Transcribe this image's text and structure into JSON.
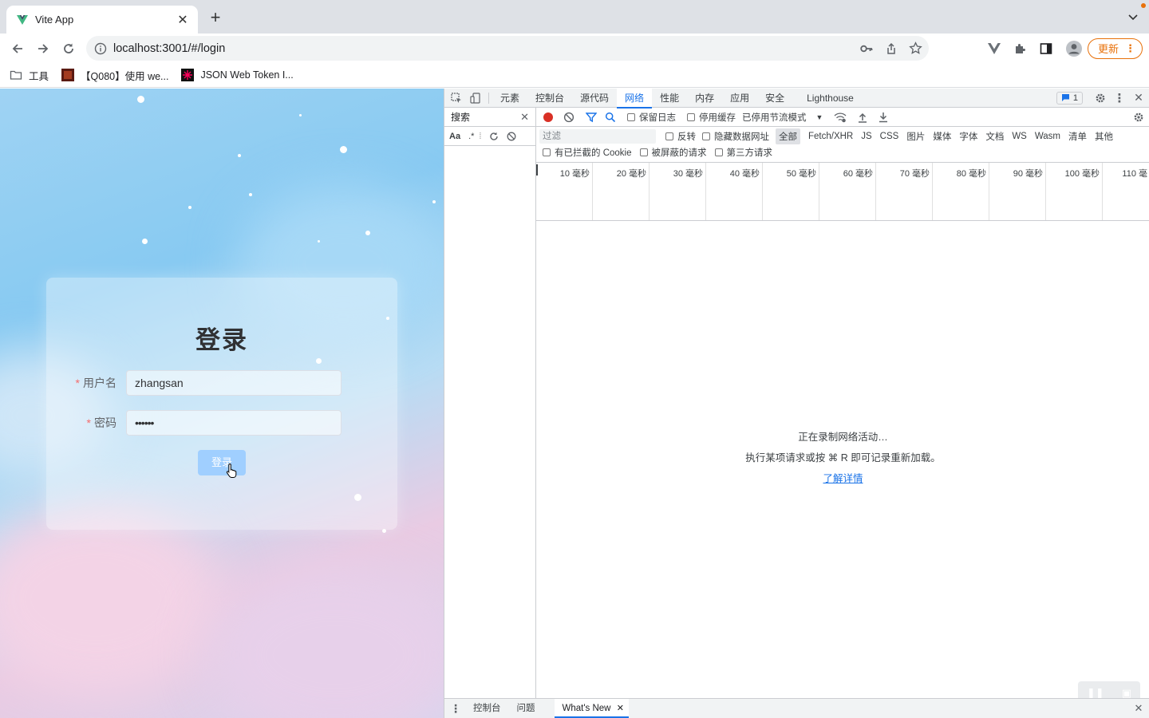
{
  "browser": {
    "tab_title": "Vite App",
    "url": "localhost:3001/#/login",
    "update_label": "更新",
    "bookmarks": [
      "工具",
      "【Q080】使用 we...",
      "JSON Web Token I..."
    ]
  },
  "login": {
    "title": "登录",
    "username_label": "用户名",
    "username_value": "zhangsan",
    "password_label": "密码",
    "password_value": "••••••",
    "required_mark": "*",
    "submit_label": "登录"
  },
  "devtools": {
    "tabs": [
      "元素",
      "控制台",
      "源代码",
      "网络",
      "性能",
      "内存",
      "应用",
      "安全",
      "Lighthouse"
    ],
    "active_tab": "网络",
    "issues_count": "1",
    "search": {
      "title": "搜索",
      "case_label": "Aa",
      "regex_label": ".*"
    },
    "network": {
      "preserve_log": "保留日志",
      "disable_cache": "停用缓存",
      "throttling": "已停用节流模式",
      "filter_placeholder": "过滤",
      "invert": "反转",
      "hide_data_urls": "隐藏数据网址",
      "types": [
        "全部",
        "Fetch/XHR",
        "JS",
        "CSS",
        "图片",
        "媒体",
        "字体",
        "文档",
        "WS",
        "Wasm",
        "清单",
        "其他"
      ],
      "blocked_cookies": "有已拦截的 Cookie",
      "blocked_requests": "被屏蔽的请求",
      "third_party": "第三方请求",
      "ticks": [
        "10 毫秒",
        "20 毫秒",
        "30 毫秒",
        "40 毫秒",
        "50 毫秒",
        "60 毫秒",
        "70 毫秒",
        "80 毫秒",
        "90 毫秒",
        "100 毫秒",
        "110 毫"
      ],
      "empty_line1": "正在录制网络活动…",
      "empty_line2": "执行某项请求或按 ⌘ R 即可记录重新加载。",
      "learn_more": "了解详情"
    },
    "drawer": {
      "tabs": [
        "控制台",
        "问题",
        "What's New"
      ]
    }
  },
  "colors": {
    "accent": "#1a73e8",
    "record_red": "#d93025",
    "update_orange": "#e8710a",
    "button_blue": "#a0cfff"
  }
}
